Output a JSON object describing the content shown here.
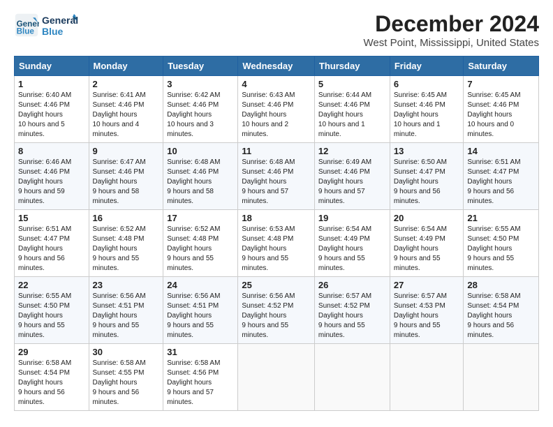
{
  "header": {
    "logo_line1": "General",
    "logo_line2": "Blue",
    "title": "December 2024",
    "subtitle": "West Point, Mississippi, United States"
  },
  "days_of_week": [
    "Sunday",
    "Monday",
    "Tuesday",
    "Wednesday",
    "Thursday",
    "Friday",
    "Saturday"
  ],
  "weeks": [
    [
      {
        "day": 1,
        "sunrise": "6:40 AM",
        "sunset": "4:46 PM",
        "daylight": "10 hours and 5 minutes."
      },
      {
        "day": 2,
        "sunrise": "6:41 AM",
        "sunset": "4:46 PM",
        "daylight": "10 hours and 4 minutes."
      },
      {
        "day": 3,
        "sunrise": "6:42 AM",
        "sunset": "4:46 PM",
        "daylight": "10 hours and 3 minutes."
      },
      {
        "day": 4,
        "sunrise": "6:43 AM",
        "sunset": "4:46 PM",
        "daylight": "10 hours and 2 minutes."
      },
      {
        "day": 5,
        "sunrise": "6:44 AM",
        "sunset": "4:46 PM",
        "daylight": "10 hours and 1 minute."
      },
      {
        "day": 6,
        "sunrise": "6:45 AM",
        "sunset": "4:46 PM",
        "daylight": "10 hours and 1 minute."
      },
      {
        "day": 7,
        "sunrise": "6:45 AM",
        "sunset": "4:46 PM",
        "daylight": "10 hours and 0 minutes."
      }
    ],
    [
      {
        "day": 8,
        "sunrise": "6:46 AM",
        "sunset": "4:46 PM",
        "daylight": "9 hours and 59 minutes."
      },
      {
        "day": 9,
        "sunrise": "6:47 AM",
        "sunset": "4:46 PM",
        "daylight": "9 hours and 58 minutes."
      },
      {
        "day": 10,
        "sunrise": "6:48 AM",
        "sunset": "4:46 PM",
        "daylight": "9 hours and 58 minutes."
      },
      {
        "day": 11,
        "sunrise": "6:48 AM",
        "sunset": "4:46 PM",
        "daylight": "9 hours and 57 minutes."
      },
      {
        "day": 12,
        "sunrise": "6:49 AM",
        "sunset": "4:46 PM",
        "daylight": "9 hours and 57 minutes."
      },
      {
        "day": 13,
        "sunrise": "6:50 AM",
        "sunset": "4:47 PM",
        "daylight": "9 hours and 56 minutes."
      },
      {
        "day": 14,
        "sunrise": "6:51 AM",
        "sunset": "4:47 PM",
        "daylight": "9 hours and 56 minutes."
      }
    ],
    [
      {
        "day": 15,
        "sunrise": "6:51 AM",
        "sunset": "4:47 PM",
        "daylight": "9 hours and 56 minutes."
      },
      {
        "day": 16,
        "sunrise": "6:52 AM",
        "sunset": "4:48 PM",
        "daylight": "9 hours and 55 minutes."
      },
      {
        "day": 17,
        "sunrise": "6:52 AM",
        "sunset": "4:48 PM",
        "daylight": "9 hours and 55 minutes."
      },
      {
        "day": 18,
        "sunrise": "6:53 AM",
        "sunset": "4:48 PM",
        "daylight": "9 hours and 55 minutes."
      },
      {
        "day": 19,
        "sunrise": "6:54 AM",
        "sunset": "4:49 PM",
        "daylight": "9 hours and 55 minutes."
      },
      {
        "day": 20,
        "sunrise": "6:54 AM",
        "sunset": "4:49 PM",
        "daylight": "9 hours and 55 minutes."
      },
      {
        "day": 21,
        "sunrise": "6:55 AM",
        "sunset": "4:50 PM",
        "daylight": "9 hours and 55 minutes."
      }
    ],
    [
      {
        "day": 22,
        "sunrise": "6:55 AM",
        "sunset": "4:50 PM",
        "daylight": "9 hours and 55 minutes."
      },
      {
        "day": 23,
        "sunrise": "6:56 AM",
        "sunset": "4:51 PM",
        "daylight": "9 hours and 55 minutes."
      },
      {
        "day": 24,
        "sunrise": "6:56 AM",
        "sunset": "4:51 PM",
        "daylight": "9 hours and 55 minutes."
      },
      {
        "day": 25,
        "sunrise": "6:56 AM",
        "sunset": "4:52 PM",
        "daylight": "9 hours and 55 minutes."
      },
      {
        "day": 26,
        "sunrise": "6:57 AM",
        "sunset": "4:52 PM",
        "daylight": "9 hours and 55 minutes."
      },
      {
        "day": 27,
        "sunrise": "6:57 AM",
        "sunset": "4:53 PM",
        "daylight": "9 hours and 55 minutes."
      },
      {
        "day": 28,
        "sunrise": "6:58 AM",
        "sunset": "4:54 PM",
        "daylight": "9 hours and 56 minutes."
      }
    ],
    [
      {
        "day": 29,
        "sunrise": "6:58 AM",
        "sunset": "4:54 PM",
        "daylight": "9 hours and 56 minutes."
      },
      {
        "day": 30,
        "sunrise": "6:58 AM",
        "sunset": "4:55 PM",
        "daylight": "9 hours and 56 minutes."
      },
      {
        "day": 31,
        "sunrise": "6:58 AM",
        "sunset": "4:56 PM",
        "daylight": "9 hours and 57 minutes."
      },
      null,
      null,
      null,
      null
    ]
  ],
  "labels": {
    "sunrise": "Sunrise: ",
    "sunset": "Sunset: ",
    "daylight": "Daylight hours"
  }
}
